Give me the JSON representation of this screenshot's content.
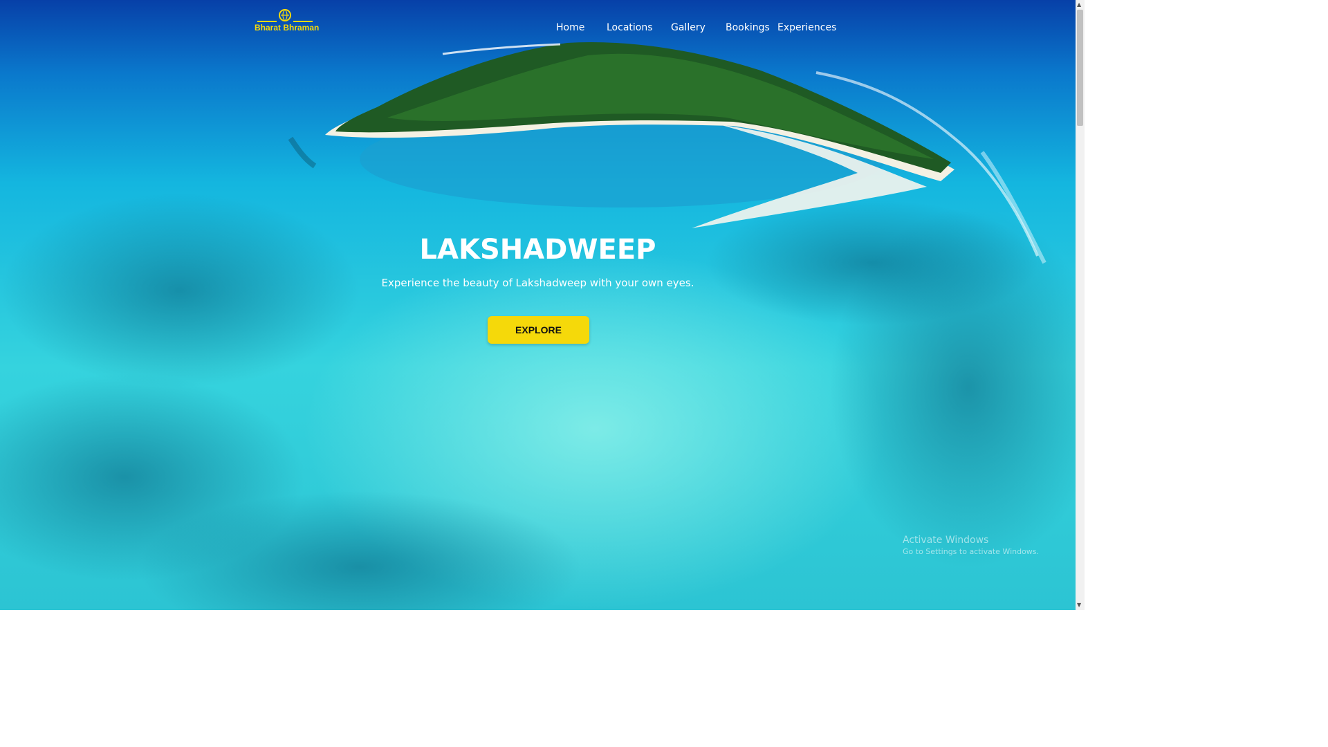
{
  "brand": {
    "name": "Bharat Bhraman",
    "color": "#f5d90a",
    "icon": "globe-leaf-icon"
  },
  "nav": {
    "items": [
      {
        "label": "Home"
      },
      {
        "label": "Locations"
      },
      {
        "label": "Gallery"
      },
      {
        "label": "Bookings"
      },
      {
        "label": "Experiences"
      }
    ]
  },
  "hero": {
    "title": "LAKSHADWEEP",
    "subtitle": "Experience the beauty of Lakshadweep with your own eyes.",
    "cta_label": "EXPLORE",
    "cta_color": "#f5d90a",
    "background": "aerial-island-lagoon-image"
  },
  "os_watermark": {
    "title": "Activate Windows",
    "subtitle": "Go to Settings to activate Windows."
  },
  "scrollbar": {
    "up_icon": "triangle-up-icon",
    "down_icon": "triangle-down-icon"
  }
}
